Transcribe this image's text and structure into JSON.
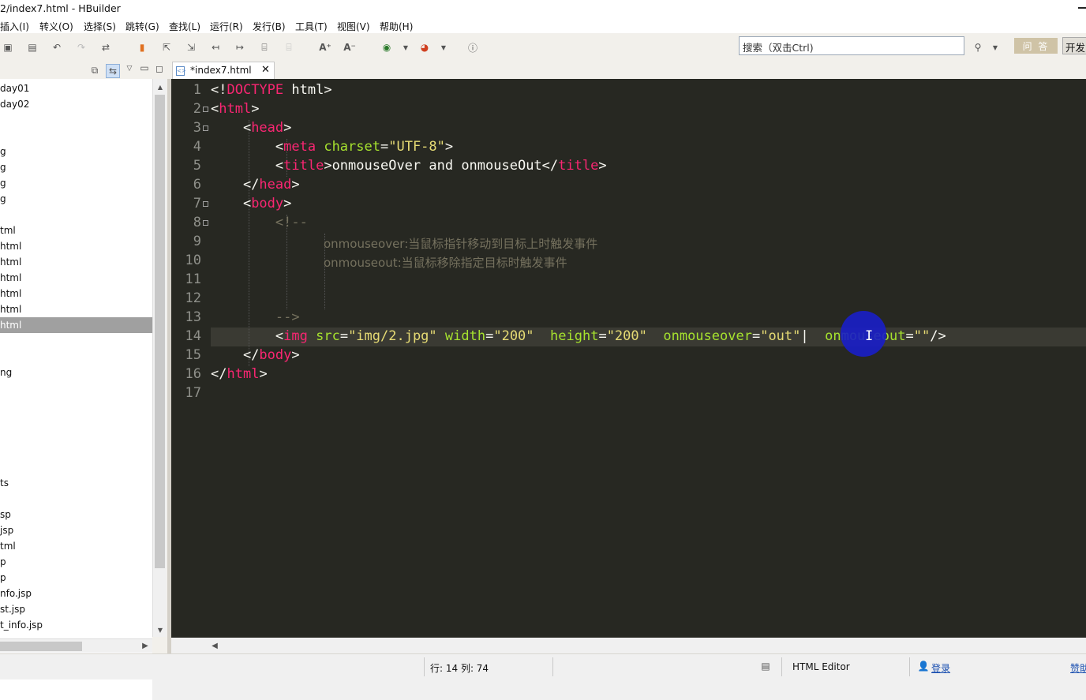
{
  "window": {
    "title": "2/index7.html  -  HBuilder"
  },
  "menu": [
    "插入(I)",
    "转义(O)",
    "选择(S)",
    "跳转(G)",
    "查找(L)",
    "运行(R)",
    "发行(B)",
    "工具(T)",
    "视图(V)",
    "帮助(H)"
  ],
  "toolbar": {
    "search_placeholder": "搜索（双击Ctrl)",
    "wenda_label": "问 答",
    "kaifa_label": "开发"
  },
  "project_tree": {
    "items": [
      "day01",
      "day02",
      "g",
      "g",
      "g",
      "g",
      "tml",
      "html",
      "html",
      "html",
      "html",
      "html",
      "html",
      "ng",
      "ts",
      "sp",
      "jsp",
      "tml",
      "p",
      "p",
      "nfo.jsp",
      "st.jsp",
      "t_info.jsp"
    ],
    "selected_index": 12
  },
  "editor": {
    "tab_label": "*index7.html",
    "line_numbers": [
      "1",
      "2",
      "3",
      "4",
      "5",
      "6",
      "7",
      "8",
      "9",
      "10",
      "11",
      "12",
      "13",
      "14",
      "15",
      "16",
      "17"
    ],
    "comment_line9": "onmouseover:当鼠标指针移动到目标上时触发事件",
    "comment_line10": "onmouseout:当鼠标移除指定目标时触发事件",
    "line5_text": "onmouseOver and onmouseOut"
  },
  "status": {
    "position": "行: 14 列: 74",
    "mode": "HTML Editor",
    "login": "登录",
    "tail": "赞助"
  }
}
